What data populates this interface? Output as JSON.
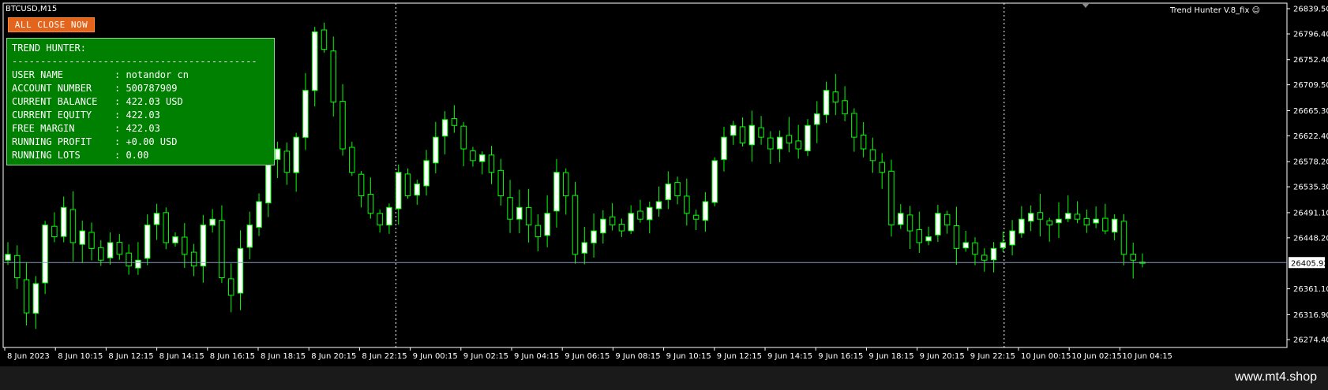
{
  "window": {
    "symbol": "BTCUSD,M15",
    "indicator": "Trend Hunter V.8_fix",
    "watermark": "www.mt4.shop"
  },
  "button": {
    "label": "ALL CLOSE NOW"
  },
  "panel": {
    "title": "TREND HUNTER:",
    "divider": "-------------------------------------------",
    "rows": [
      {
        "label": "USER NAME",
        "value": "notandor cn"
      },
      {
        "label": "ACCOUNT NUMBER",
        "value": "500787909"
      },
      {
        "label": "CURRENT BALANCE",
        "value": "422.03 USD"
      },
      {
        "label": "CURRENT EQUITY",
        "value": "422.03"
      },
      {
        "label": "FREE MARGIN",
        "value": "422.03"
      },
      {
        "label": "RUNNING PROFIT",
        "value": "+0.00 USD"
      },
      {
        "label": "RUNNING LOTS",
        "value": "0.00"
      }
    ]
  },
  "colors": {
    "background": "#000000",
    "grid": "#ffffff",
    "candle_bull": "#ffffff",
    "candle_outline": "#00ff00",
    "bid_line": "#8a9ab8",
    "panel_bg": "#008000",
    "button_bg": "#e3651d"
  },
  "chart_data": {
    "type": "candlestick",
    "y_ticks": [
      "26839.50",
      "26796.40",
      "26752.40",
      "26709.50",
      "26665.30",
      "26622.40",
      "26578.20",
      "26535.30",
      "26491.10",
      "26448.20",
      "26405.92",
      "26361.10",
      "26316.90",
      "26274.40"
    ],
    "y_tick_values": [
      26839.5,
      26796.4,
      26752.4,
      26709.5,
      26665.3,
      26622.4,
      26578.2,
      26535.3,
      26491.1,
      26448.2,
      26361.1,
      26316.9,
      26274.4
    ],
    "ylim": [
      26274.4,
      26839.5
    ],
    "current_price": "26405.92",
    "current_price_value": 26405.92,
    "x_ticks": [
      "8 Jun 2023",
      "8 Jun 10:15",
      "8 Jun 12:15",
      "8 Jun 14:15",
      "8 Jun 16:15",
      "8 Jun 18:15",
      "8 Jun 20:15",
      "8 Jun 22:15",
      "9 Jun 00:15",
      "9 Jun 02:15",
      "9 Jun 04:15",
      "9 Jun 06:15",
      "9 Jun 08:15",
      "9 Jun 10:15",
      "9 Jun 12:15",
      "9 Jun 14:15",
      "9 Jun 16:15",
      "9 Jun 18:15",
      "9 Jun 20:15",
      "9 Jun 22:15",
      "10 Jun 00:15",
      "10 Jun 02:15",
      "10 Jun 04:15"
    ],
    "day_separators_after_tick": [
      7,
      19
    ],
    "price_path": [
      26420,
      26380,
      26320,
      26370,
      26470,
      26450,
      26500,
      26440,
      26460,
      26430,
      26410,
      26440,
      26420,
      26400,
      26410,
      26470,
      26490,
      26440,
      26450,
      26420,
      26400,
      26470,
      26480,
      26380,
      26350,
      26430,
      26470,
      26510,
      26580,
      26600,
      26560,
      26620,
      26700,
      26800,
      26770,
      26680,
      26600,
      26560,
      26520,
      26490,
      26470,
      26500,
      26560,
      26520,
      26540,
      26580,
      26620,
      26650,
      26640,
      26600,
      26580,
      26590,
      26560,
      26520,
      26480,
      26500,
      26470,
      26450,
      26490,
      26560,
      26520,
      26420,
      26440,
      26460,
      26480,
      26470,
      26460,
      26490,
      26480,
      26500,
      26510,
      26540,
      26520,
      26490,
      26480,
      26510,
      26580,
      26620,
      26640,
      26610,
      26640,
      26620,
      26600,
      26620,
      26610,
      26600,
      26640,
      26660,
      26700,
      26680,
      26660,
      26620,
      26600,
      26580,
      26560,
      26470,
      26490,
      26460,
      26440,
      26450,
      26490,
      26470,
      26430,
      26440,
      26420,
      26410,
      26430,
      26440,
      26460,
      26480,
      26490,
      26480,
      26470,
      26480,
      26490,
      26480,
      26470,
      26480,
      26460,
      26480,
      26420,
      26410,
      26405
    ]
  }
}
